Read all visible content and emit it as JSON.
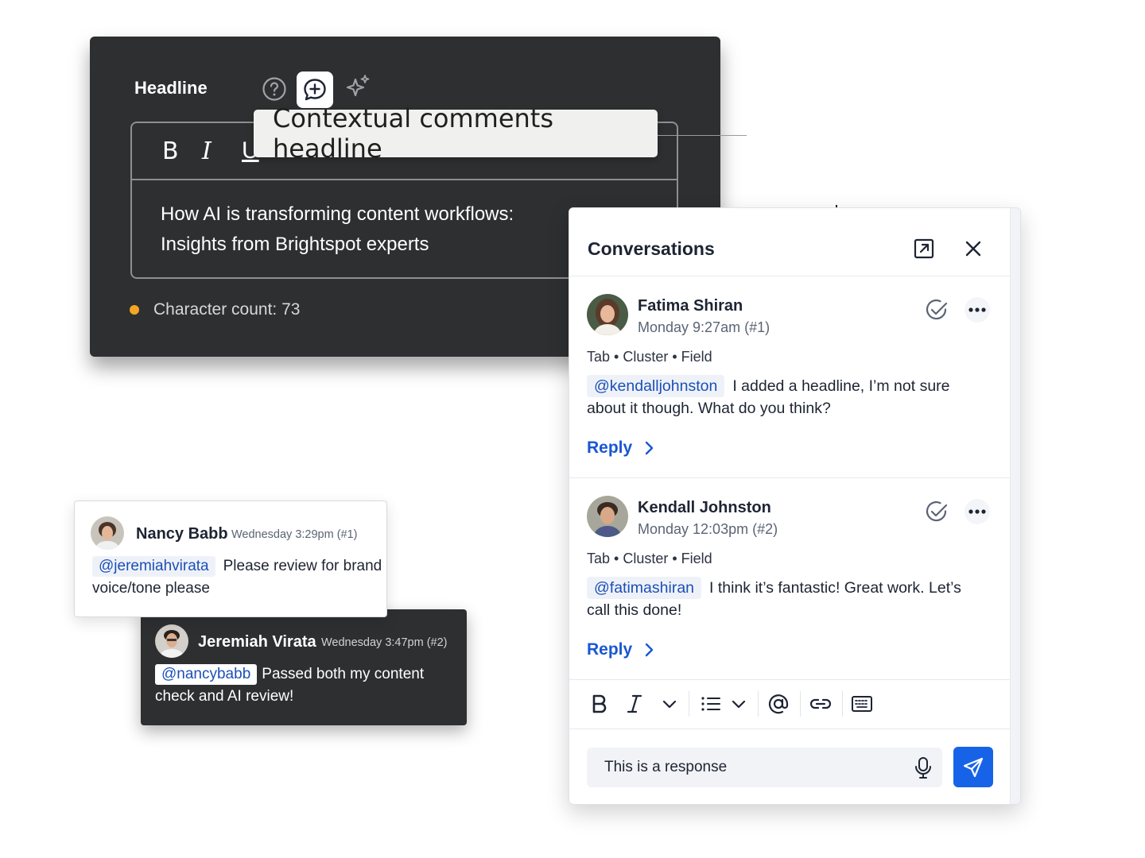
{
  "editor": {
    "label": "Headline",
    "toolbar": {
      "bold": "B",
      "italic": "I",
      "underline": "U"
    },
    "content_line1": "How AI is transforming content workflows:",
    "content_line2": "Insights from Brightspot experts",
    "char_count": "Character count: 73",
    "icons": [
      "help-icon",
      "add-comment-icon",
      "ai-sparkle-icon"
    ]
  },
  "tooltip": {
    "text": "Contextual comments headline"
  },
  "conversations": {
    "title": "Conversations",
    "comments": [
      {
        "name": "Fatima Shiran",
        "time": "Monday 9:27am (#1)",
        "path": "Tab • Cluster • Field",
        "mention": "@kendalljohnston",
        "text": "I added a headline, I’m not sure about it though. What do you think?",
        "reply": "Reply"
      },
      {
        "name": "Kendall Johnston",
        "time": "Monday 12:03pm (#2)",
        "path": "Tab • Cluster • Field",
        "mention": "@fatimashiran",
        "text": "I think it’s fantastic! Great work. Let’s call this done!",
        "reply": "Reply"
      }
    ],
    "input_value": "This is a response",
    "toolbar_icons": [
      "bold-icon",
      "italic-icon",
      "chevron-down-icon",
      "list-icon",
      "chevron-down-icon",
      "at-icon",
      "link-icon",
      "keyboard-icon"
    ],
    "accent": "#1763e8"
  },
  "mini_cards": [
    {
      "name": "Nancy Babb",
      "time": "Wednesday 3:29pm (#1)",
      "mention": "@jeremiahvirata",
      "text": "Please review for brand voice/tone please"
    },
    {
      "name": "Jeremiah Virata",
      "time": "Wednesday 3:47pm (#2)",
      "mention": "@nancybabb",
      "text": "Passed both my content check and AI review!"
    }
  ],
  "colors": {
    "dark_panel": "#2e2f31",
    "mention_blue": "#1d4fb8",
    "status_dot": "#f5a623"
  }
}
